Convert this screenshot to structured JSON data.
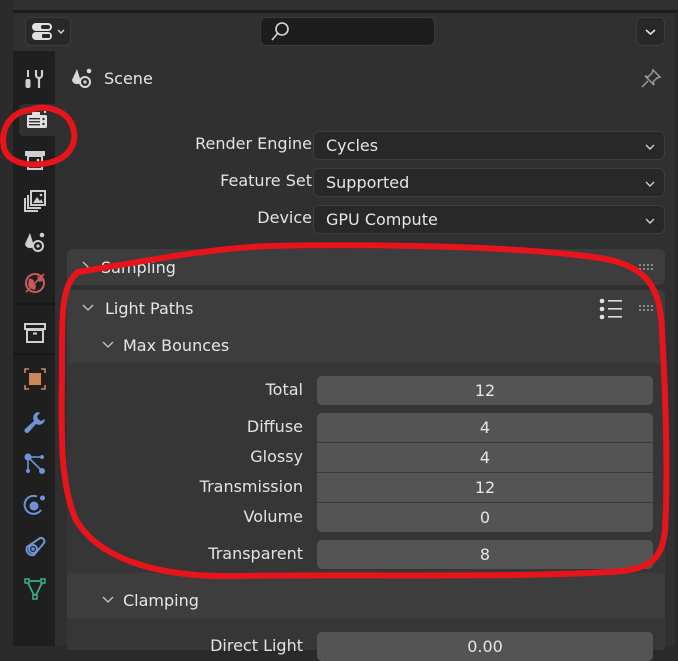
{
  "header": {
    "editor_type_icon": "properties-editor-icon",
    "search_placeholder": "",
    "search_icon": "search-icon"
  },
  "tabs": [
    {
      "name": "tool",
      "icon": "tool-icon"
    },
    {
      "name": "render",
      "icon": "render-camera-icon",
      "active": true
    },
    {
      "name": "output",
      "icon": "output-printer-icon"
    },
    {
      "name": "view-layer",
      "icon": "view-layer-icon"
    },
    {
      "name": "scene",
      "icon": "scene-icon"
    },
    {
      "name": "world",
      "icon": "world-icon"
    },
    {
      "name": "collection",
      "icon": "collection-icon"
    },
    {
      "name": "object",
      "icon": "object-icon"
    },
    {
      "name": "modifiers",
      "icon": "wrench-icon"
    },
    {
      "name": "particles",
      "icon": "particles-icon"
    },
    {
      "name": "physics",
      "icon": "physics-icon"
    },
    {
      "name": "constraints",
      "icon": "constraints-icon"
    },
    {
      "name": "data",
      "icon": "mesh-data-icon"
    }
  ],
  "context": {
    "label": "Scene"
  },
  "render": {
    "render_engine_label": "Render Engine",
    "render_engine_value": "Cycles",
    "feature_set_label": "Feature Set",
    "feature_set_value": "Supported",
    "device_label": "Device",
    "device_value": "GPU Compute"
  },
  "panels": {
    "sampling": {
      "title": "Sampling",
      "expanded": false
    },
    "light_paths": {
      "title": "Light Paths",
      "expanded": true,
      "max_bounces": {
        "title": "Max Bounces",
        "fields": [
          {
            "label": "Total",
            "value": "12"
          },
          {
            "label": "Diffuse",
            "value": "4"
          },
          {
            "label": "Glossy",
            "value": "4"
          },
          {
            "label": "Transmission",
            "value": "12"
          },
          {
            "label": "Volume",
            "value": "0"
          },
          {
            "label": "Transparent",
            "value": "8"
          }
        ]
      },
      "clamping": {
        "title": "Clamping",
        "fields": [
          {
            "label": "Direct Light",
            "value": "0.00"
          }
        ]
      }
    }
  },
  "colors": {
    "annotation": "#e8141c",
    "object_orange": "#c9875a",
    "modifier_blue": "#6f92d8",
    "data_green": "#36b087",
    "world_red": "#c9595c"
  }
}
